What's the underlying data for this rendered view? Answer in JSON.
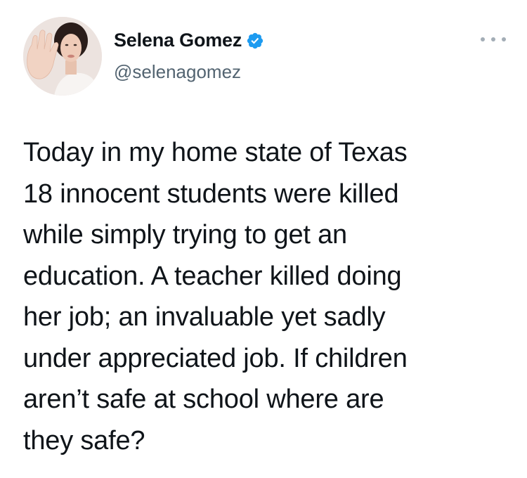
{
  "author": {
    "display_name": "Selena Gomez",
    "handle": "@selenagomez",
    "verified": true,
    "avatar_icon": "profile-photo",
    "verified_icon": "verified-badge-icon",
    "verified_color": "#1d9bf0"
  },
  "tweet": {
    "text": "Today in my home state of Texas\n18 innocent students were killed\nwhile simply trying to get an\neducation. A teacher killed doing\nher job; an invaluable yet sadly\nunder appreciated job. If children\naren’t safe at school where are\nthey safe?"
  },
  "actions": {
    "more_icon": "more-options-icon"
  },
  "colors": {
    "text": "#0f1419",
    "secondary": "#536471",
    "background": "#ffffff"
  }
}
